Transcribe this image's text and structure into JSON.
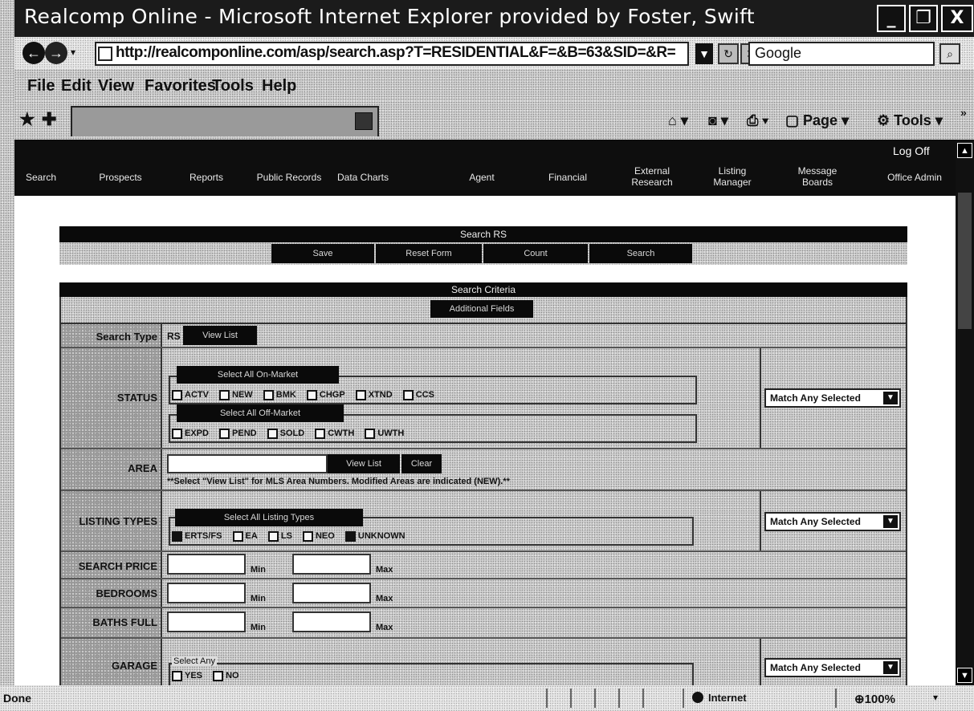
{
  "window": {
    "title": "Realcomp Online - Microsoft Internet Explorer provided by Foster, Swift",
    "minimize": "_",
    "maximize": "❐",
    "close": "X"
  },
  "address": {
    "url": "http://realcomponline.com/asp/search.asp?T=RESIDENTIAL&F=&B=63&SID=&R=",
    "search_engine": "Google"
  },
  "menu": [
    "File",
    "Edit",
    "View",
    "Favorites",
    "Tools",
    "Help"
  ],
  "commandbar": {
    "page_label": "Page",
    "tools_label": "Tools"
  },
  "app": {
    "logoff": "Log Off",
    "nav": [
      {
        "label": "Search"
      },
      {
        "label": "Prospects"
      },
      {
        "label": "Reports"
      },
      {
        "label": "Public Records"
      },
      {
        "label": "Data Charts"
      },
      {
        "label": "Agent"
      },
      {
        "label": "Financial"
      },
      {
        "label": "External Research"
      },
      {
        "label": "Listing Manager"
      },
      {
        "label": "Message Boards"
      },
      {
        "label": "Office Admin"
      }
    ]
  },
  "search_panel": {
    "title": "Search RS",
    "buttons": {
      "save": "Save",
      "reset": "Reset Form",
      "count": "Count",
      "search": "Search"
    }
  },
  "criteria": {
    "title": "Search Criteria",
    "additional": "Additional Fields",
    "search_type": {
      "label": "Search Type",
      "value": "RS",
      "button": "View List"
    },
    "status": {
      "label": "STATUS",
      "on_market_btn": "Select All On-Market",
      "on_market": [
        "ACTV",
        "NEW",
        "BMK",
        "CHGP",
        "XTND",
        "CCS"
      ],
      "off_market_btn": "Select All Off-Market",
      "off_market": [
        "EXPD",
        "PEND",
        "SOLD",
        "CWTH",
        "UWTH"
      ],
      "match": "Match Any Selected"
    },
    "area": {
      "label": "AREA",
      "view_list": "View List",
      "clear": "Clear",
      "note": "**Select \"View List\" for MLS Area Numbers. Modified Areas are indicated (NEW).**"
    },
    "listing_types": {
      "label": "LISTING TYPES",
      "select_all": "Select All Listing Types",
      "items": [
        {
          "label": "ERTS/FS",
          "checked": true
        },
        {
          "label": "EA",
          "checked": false
        },
        {
          "label": "LS",
          "checked": false
        },
        {
          "label": "NEO",
          "checked": false
        },
        {
          "label": "UNKNOWN",
          "checked": true
        }
      ],
      "match": "Match Any Selected"
    },
    "search_price": {
      "label": "SEARCH PRICE",
      "min": "Min",
      "max": "Max"
    },
    "bedrooms": {
      "label": "BEDROOMS",
      "min": "Min",
      "max": "Max"
    },
    "baths": {
      "label": "BATHS FULL",
      "min": "Min",
      "max": "Max"
    },
    "garage": {
      "label": "GARAGE",
      "select_any": "Select Any",
      "items": [
        "YES",
        "NO"
      ],
      "match": "Match Any Selected"
    }
  },
  "statusbar": {
    "left": "Done",
    "zone": "Internet",
    "zoom": "100%"
  }
}
